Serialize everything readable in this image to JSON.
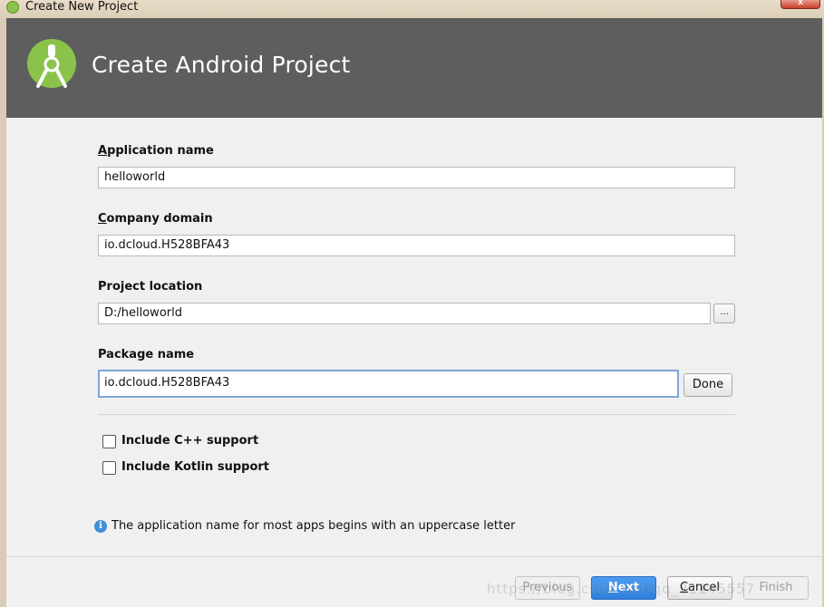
{
  "window": {
    "title": "Create New Project",
    "close_label": "x"
  },
  "header": {
    "title": "Create Android Project",
    "accent_color": "#8bc34a",
    "background_color": "#5e5e5e"
  },
  "fields": {
    "application_name": {
      "label_first": "A",
      "label_rest": "pplication name",
      "value": "helloworld"
    },
    "company_domain": {
      "label_first": "C",
      "label_rest": "ompany domain",
      "value": "io.dcloud.H528BFA43"
    },
    "project_location": {
      "label": "Project location",
      "value": "D:/helloworld",
      "browse_label": "..."
    },
    "package_name": {
      "label": "Package name",
      "value": "io.dcloud.H528BFA43",
      "done_label": "Done"
    }
  },
  "options": {
    "cpp": {
      "label": "Include C++ support",
      "checked": false
    },
    "kotlin": {
      "label": "Include Kotlin support",
      "checked": false
    }
  },
  "hint": {
    "icon": "info-icon",
    "text": "The application name for most apps begins with an uppercase letter"
  },
  "footer": {
    "previous_label": "Previous",
    "next_first": "N",
    "next_rest": "ext",
    "cancel_first": "C",
    "cancel_rest": "ancel",
    "finish_label": "Finish",
    "watermark": "https://blog.csdn.net/qq_21145557"
  }
}
